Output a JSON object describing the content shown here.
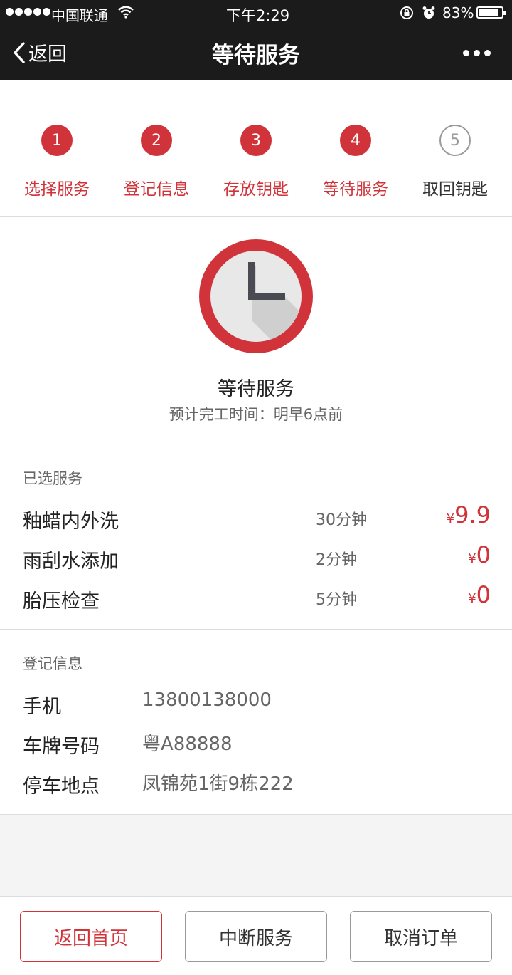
{
  "status_bar": {
    "carrier": "中国联通",
    "time": "下午2:29",
    "battery": "83%",
    "battery_level": 0.83
  },
  "nav": {
    "back_label": "返回",
    "title": "等待服务"
  },
  "steps": [
    {
      "number": "1",
      "label": "选择服务",
      "state": "done"
    },
    {
      "number": "2",
      "label": "登记信息",
      "state": "done"
    },
    {
      "number": "3",
      "label": "存放钥匙",
      "state": "done"
    },
    {
      "number": "4",
      "label": "等待服务",
      "state": "done"
    },
    {
      "number": "5",
      "label": "取回钥匙",
      "state": "todo"
    }
  ],
  "waiting": {
    "title": "等待服务",
    "subtitle": "预计完工时间：明早6点前"
  },
  "services": {
    "heading": "已选服务",
    "items": [
      {
        "name": "釉蜡内外洗",
        "duration": "30分钟",
        "currency": "¥",
        "price": "9.9"
      },
      {
        "name": "雨刮水添加",
        "duration": "2分钟",
        "currency": "¥",
        "price": "0"
      },
      {
        "name": "胎压检查",
        "duration": "5分钟",
        "currency": "¥",
        "price": "0"
      }
    ]
  },
  "registration": {
    "heading": "登记信息",
    "rows": [
      {
        "label": "手机",
        "value": "13800138000"
      },
      {
        "label": "车牌号码",
        "value": "粤A88888"
      },
      {
        "label": "停车地点",
        "value": "凤锦苑1街9栋222"
      }
    ]
  },
  "actions": {
    "home": "返回首页",
    "interrupt": "中断服务",
    "cancel": "取消订单"
  },
  "colors": {
    "accent": "#d0343a",
    "topbar": "#1b1b1b"
  }
}
